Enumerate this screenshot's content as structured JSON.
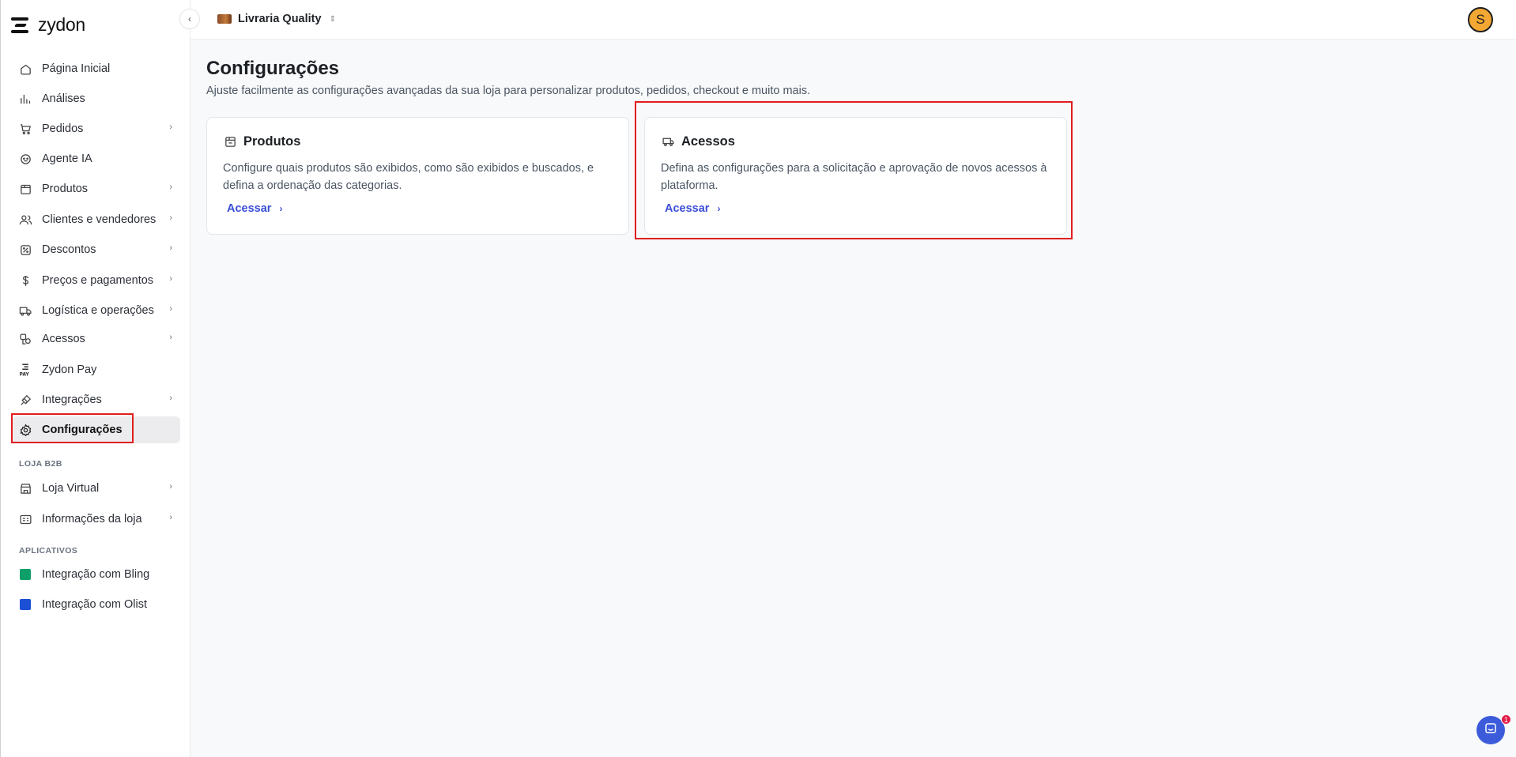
{
  "brand": {
    "name": "zydon"
  },
  "topbar": {
    "store_name": "Livraria Quality",
    "avatar_initial": "S"
  },
  "sidebar": {
    "items": [
      {
        "label": "Página Inicial",
        "icon": "home-icon",
        "has_chevron": false
      },
      {
        "label": "Análises",
        "icon": "bar-chart-icon",
        "has_chevron": false
      },
      {
        "label": "Pedidos",
        "icon": "cart-icon",
        "has_chevron": true
      },
      {
        "label": "Agente IA",
        "icon": "bot-icon",
        "has_chevron": false
      },
      {
        "label": "Produtos",
        "icon": "package-icon",
        "has_chevron": true
      },
      {
        "label": "Clientes e vendedores",
        "icon": "users-icon",
        "has_chevron": true
      },
      {
        "label": "Descontos",
        "icon": "discount-icon",
        "has_chevron": true
      },
      {
        "label": "Preços e pagamentos",
        "icon": "dollar-icon",
        "has_chevron": true
      },
      {
        "label": "Logística e operações",
        "icon": "truck-icon",
        "has_chevron": true
      },
      {
        "label": "Acessos",
        "icon": "access-icon",
        "has_chevron": true
      },
      {
        "label": "Zydon Pay",
        "icon": "zydon-pay-icon",
        "has_chevron": false
      },
      {
        "label": "Integrações",
        "icon": "plug-icon",
        "has_chevron": true
      },
      {
        "label": "Configurações",
        "icon": "gear-icon",
        "has_chevron": false,
        "active": true
      }
    ],
    "section_b2b": "LOJA B2B",
    "b2b_items": [
      {
        "label": "Loja Virtual",
        "icon": "store-icon",
        "has_chevron": true
      },
      {
        "label": "Informações da loja",
        "icon": "info-card-icon",
        "has_chevron": true
      }
    ],
    "section_apps": "APLICATIVOS",
    "app_items": [
      {
        "label": "Integração com Bling",
        "icon": "bling-icon"
      },
      {
        "label": "Integração com Olist",
        "icon": "olist-icon"
      }
    ]
  },
  "main": {
    "title": "Configurações",
    "subtitle": "Ajuste facilmente as configurações avançadas da sua loja para personalizar produtos, pedidos, checkout e muito mais.",
    "cards": [
      {
        "title": "Produtos",
        "description": "Configure quais produtos são exibidos, como são exibidos e buscados, e defina a ordenação das categorias.",
        "link": "Acessar"
      },
      {
        "title": "Acessos",
        "description": "Defina as configurações para a solicitação e aprovação de novos acessos à plataforma.",
        "link": "Acessar"
      }
    ]
  },
  "chat": {
    "badge_count": "1"
  },
  "colors": {
    "accent": "#3b4fd8",
    "highlight": "#e11d1d",
    "avatar": "#f3a833"
  }
}
